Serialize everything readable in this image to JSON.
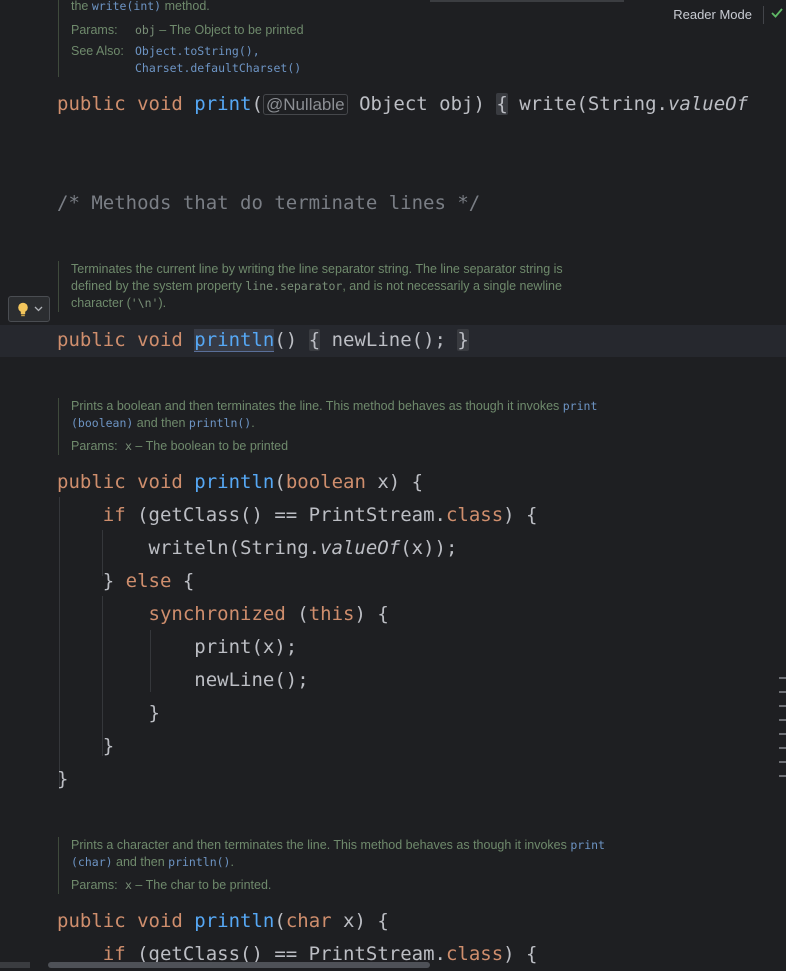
{
  "header": {
    "reader_mode": "Reader Mode"
  },
  "doc1": {
    "prefix": "the ",
    "code": "write(int)",
    "suffix": " method.",
    "params_label": "Params:",
    "param_name": "obj",
    "param_desc": " – The Object to be printed",
    "see_label": "See Also:",
    "see1": "Object.toString(),",
    "see2": "Charset.defaultCharset()"
  },
  "line_print": {
    "kw": "public void ",
    "fn": "print",
    "open": "(",
    "ann": "@Nullable",
    "rest": " Object obj) ",
    "brace": "{",
    "body": " write(String.",
    "method": "valueOf"
  },
  "comment": "/* Methods that do terminate lines */",
  "doc2": {
    "line1": "Terminates the current line by writing the line separator string. The line separator string is",
    "line2a": "defined by the system property ",
    "line2code": "line.separator",
    "line2b": ", and is not necessarily a single newline",
    "line3a": "character (",
    "line3code": "'\\n'",
    "line3b": ")."
  },
  "line_println": {
    "kw": "public void ",
    "fn": "println",
    "paren": "() ",
    "brace_open": "{",
    "body": " newLine(); ",
    "brace_close": "}"
  },
  "doc3": {
    "line1a": "Prints a boolean and then terminates the line. This method behaves as though it invokes ",
    "line1code": "print",
    "line2code": "(boolean)",
    "line2b": " and then ",
    "line2code2": "println()",
    "line2c": ".",
    "params_label": "Params:",
    "param": "x",
    "param_desc": " – The boolean to be printed"
  },
  "bool_method": {
    "l1_kw": "public void ",
    "l1_fn": "println",
    "l1_a": "(",
    "l1_kw2": "boolean",
    "l1_b": " x) {",
    "l2_kw": "if",
    "l2_a": " (getClass() == PrintStream.",
    "l2_kw2": "class",
    "l2_b": ") {",
    "l3_a": "writeln(String.",
    "l3_it": "valueOf",
    "l3_b": "(x));",
    "l4_a": "} ",
    "l4_kw": "else",
    "l4_b": " {",
    "l5_kw": "synchronized",
    "l5_a": " (",
    "l5_kw2": "this",
    "l5_b": ") {",
    "l6": "print(x);",
    "l7": "newLine();",
    "l8": "}",
    "l9": "}",
    "l10": "}"
  },
  "doc4": {
    "line1a": "Prints a character and then terminates the line. This method behaves as though it invokes ",
    "line1code": "print",
    "line2code": "(char)",
    "line2b": " and then ",
    "line2code2": "println()",
    "line2c": ".",
    "params_label": "Params:",
    "param": "x",
    "param_desc": " – The char to be printed."
  },
  "char_method": {
    "l1_kw": "public void ",
    "l1_fn": "println",
    "l1_a": "(",
    "l1_kw2": "char",
    "l1_b": " x) {",
    "l2_kw": "if",
    "l2_a": " (getClass() == PrintStream.",
    "l2_kw2": "class",
    "l2_b": ") {"
  },
  "icons": {
    "check": "check-icon",
    "bulb": "lightbulb-icon",
    "chevron": "chevron-down-icon"
  },
  "colors": {
    "background": "#1e1f22",
    "keyword": "#cf8e6d",
    "function": "#56a8f5",
    "doc_text": "#6f8a6c",
    "comment": "#7a7e85"
  }
}
